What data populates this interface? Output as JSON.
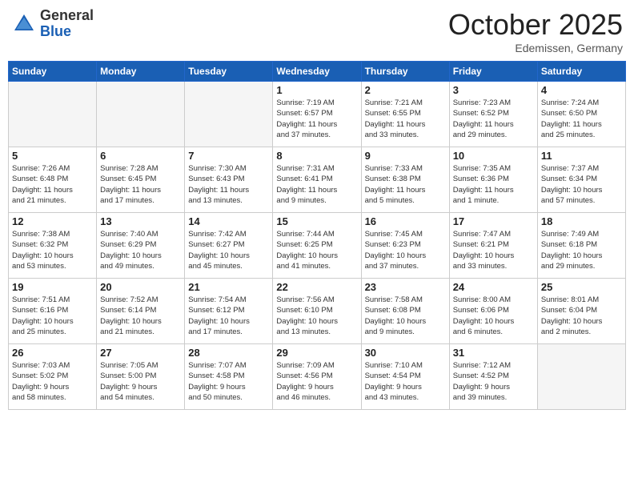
{
  "header": {
    "logo_general": "General",
    "logo_blue": "Blue",
    "month_title": "October 2025",
    "location": "Edemissen, Germany"
  },
  "calendar": {
    "weekdays": [
      "Sunday",
      "Monday",
      "Tuesday",
      "Wednesday",
      "Thursday",
      "Friday",
      "Saturday"
    ],
    "weeks": [
      [
        {
          "day": "",
          "info": ""
        },
        {
          "day": "",
          "info": ""
        },
        {
          "day": "",
          "info": ""
        },
        {
          "day": "1",
          "info": "Sunrise: 7:19 AM\nSunset: 6:57 PM\nDaylight: 11 hours\nand 37 minutes."
        },
        {
          "day": "2",
          "info": "Sunrise: 7:21 AM\nSunset: 6:55 PM\nDaylight: 11 hours\nand 33 minutes."
        },
        {
          "day": "3",
          "info": "Sunrise: 7:23 AM\nSunset: 6:52 PM\nDaylight: 11 hours\nand 29 minutes."
        },
        {
          "day": "4",
          "info": "Sunrise: 7:24 AM\nSunset: 6:50 PM\nDaylight: 11 hours\nand 25 minutes."
        }
      ],
      [
        {
          "day": "5",
          "info": "Sunrise: 7:26 AM\nSunset: 6:48 PM\nDaylight: 11 hours\nand 21 minutes."
        },
        {
          "day": "6",
          "info": "Sunrise: 7:28 AM\nSunset: 6:45 PM\nDaylight: 11 hours\nand 17 minutes."
        },
        {
          "day": "7",
          "info": "Sunrise: 7:30 AM\nSunset: 6:43 PM\nDaylight: 11 hours\nand 13 minutes."
        },
        {
          "day": "8",
          "info": "Sunrise: 7:31 AM\nSunset: 6:41 PM\nDaylight: 11 hours\nand 9 minutes."
        },
        {
          "day": "9",
          "info": "Sunrise: 7:33 AM\nSunset: 6:38 PM\nDaylight: 11 hours\nand 5 minutes."
        },
        {
          "day": "10",
          "info": "Sunrise: 7:35 AM\nSunset: 6:36 PM\nDaylight: 11 hours\nand 1 minute."
        },
        {
          "day": "11",
          "info": "Sunrise: 7:37 AM\nSunset: 6:34 PM\nDaylight: 10 hours\nand 57 minutes."
        }
      ],
      [
        {
          "day": "12",
          "info": "Sunrise: 7:38 AM\nSunset: 6:32 PM\nDaylight: 10 hours\nand 53 minutes."
        },
        {
          "day": "13",
          "info": "Sunrise: 7:40 AM\nSunset: 6:29 PM\nDaylight: 10 hours\nand 49 minutes."
        },
        {
          "day": "14",
          "info": "Sunrise: 7:42 AM\nSunset: 6:27 PM\nDaylight: 10 hours\nand 45 minutes."
        },
        {
          "day": "15",
          "info": "Sunrise: 7:44 AM\nSunset: 6:25 PM\nDaylight: 10 hours\nand 41 minutes."
        },
        {
          "day": "16",
          "info": "Sunrise: 7:45 AM\nSunset: 6:23 PM\nDaylight: 10 hours\nand 37 minutes."
        },
        {
          "day": "17",
          "info": "Sunrise: 7:47 AM\nSunset: 6:21 PM\nDaylight: 10 hours\nand 33 minutes."
        },
        {
          "day": "18",
          "info": "Sunrise: 7:49 AM\nSunset: 6:18 PM\nDaylight: 10 hours\nand 29 minutes."
        }
      ],
      [
        {
          "day": "19",
          "info": "Sunrise: 7:51 AM\nSunset: 6:16 PM\nDaylight: 10 hours\nand 25 minutes."
        },
        {
          "day": "20",
          "info": "Sunrise: 7:52 AM\nSunset: 6:14 PM\nDaylight: 10 hours\nand 21 minutes."
        },
        {
          "day": "21",
          "info": "Sunrise: 7:54 AM\nSunset: 6:12 PM\nDaylight: 10 hours\nand 17 minutes."
        },
        {
          "day": "22",
          "info": "Sunrise: 7:56 AM\nSunset: 6:10 PM\nDaylight: 10 hours\nand 13 minutes."
        },
        {
          "day": "23",
          "info": "Sunrise: 7:58 AM\nSunset: 6:08 PM\nDaylight: 10 hours\nand 9 minutes."
        },
        {
          "day": "24",
          "info": "Sunrise: 8:00 AM\nSunset: 6:06 PM\nDaylight: 10 hours\nand 6 minutes."
        },
        {
          "day": "25",
          "info": "Sunrise: 8:01 AM\nSunset: 6:04 PM\nDaylight: 10 hours\nand 2 minutes."
        }
      ],
      [
        {
          "day": "26",
          "info": "Sunrise: 7:03 AM\nSunset: 5:02 PM\nDaylight: 9 hours\nand 58 minutes."
        },
        {
          "day": "27",
          "info": "Sunrise: 7:05 AM\nSunset: 5:00 PM\nDaylight: 9 hours\nand 54 minutes."
        },
        {
          "day": "28",
          "info": "Sunrise: 7:07 AM\nSunset: 4:58 PM\nDaylight: 9 hours\nand 50 minutes."
        },
        {
          "day": "29",
          "info": "Sunrise: 7:09 AM\nSunset: 4:56 PM\nDaylight: 9 hours\nand 46 minutes."
        },
        {
          "day": "30",
          "info": "Sunrise: 7:10 AM\nSunset: 4:54 PM\nDaylight: 9 hours\nand 43 minutes."
        },
        {
          "day": "31",
          "info": "Sunrise: 7:12 AM\nSunset: 4:52 PM\nDaylight: 9 hours\nand 39 minutes."
        },
        {
          "day": "",
          "info": ""
        }
      ]
    ]
  }
}
